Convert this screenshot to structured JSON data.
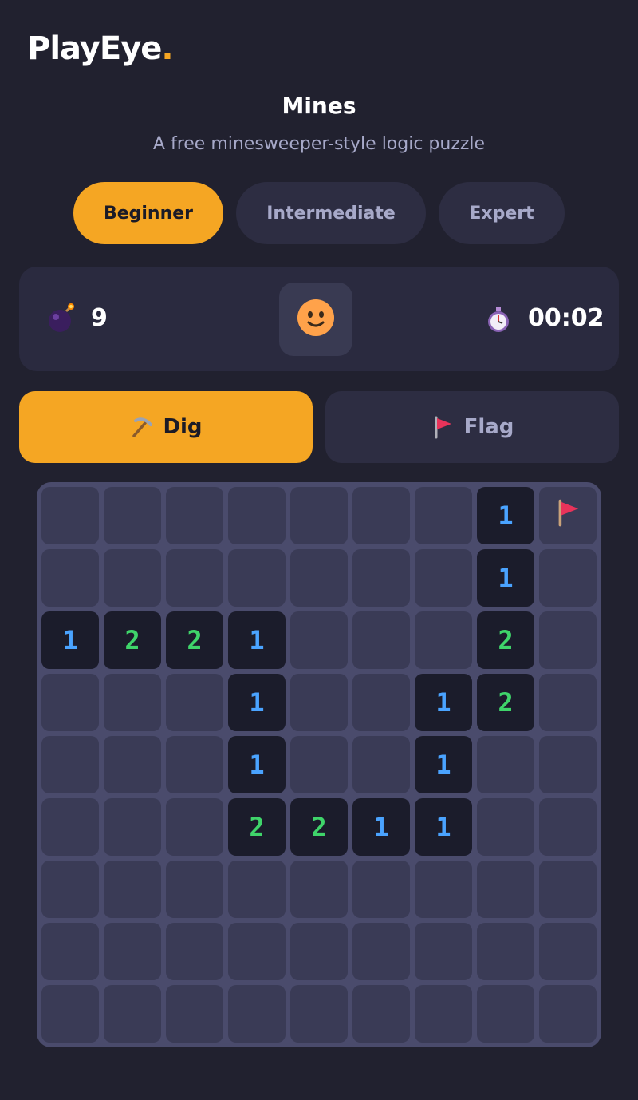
{
  "header": {
    "logo_main": "PlayEye",
    "logo_dot": "."
  },
  "game": {
    "title": "Mines",
    "subtitle": "A free minesweeper-style logic puzzle"
  },
  "difficulty": {
    "options": [
      "Beginner",
      "Intermediate",
      "Expert"
    ],
    "selected": "Beginner"
  },
  "status": {
    "mines_remaining": "9",
    "timer": "00:02",
    "mines_icon": "bomb-icon",
    "face_icon": "smiley-face-icon",
    "timer_icon": "stopwatch-icon"
  },
  "modes": {
    "dig_label": "Dig",
    "flag_label": "Flag",
    "selected": "Dig",
    "dig_icon": "pickaxe-icon",
    "flag_icon": "flag-icon"
  },
  "colors": {
    "accent": "#f5a623",
    "background": "#21212f",
    "number_1": "#4aa3ff",
    "number_2": "#3fd46a"
  },
  "board": {
    "rows": 9,
    "cols": 9,
    "legend": "H = hidden, F = flagged, 0 = revealed empty, digits = adjacent mine count",
    "grid": [
      [
        "H",
        "H",
        "H",
        "H",
        "H",
        "H",
        "H",
        "1",
        "F"
      ],
      [
        "H",
        "H",
        "H",
        "H",
        "H",
        "H",
        "H",
        "1",
        "H"
      ],
      [
        "1",
        "2",
        "2",
        "1",
        "H",
        "H",
        "H",
        "2",
        "H"
      ],
      [
        "H",
        "H",
        "H",
        "1",
        "H",
        "H",
        "1",
        "2",
        "H"
      ],
      [
        "H",
        "H",
        "H",
        "1",
        "H",
        "H",
        "1",
        "H",
        "H"
      ],
      [
        "H",
        "H",
        "H",
        "2",
        "2",
        "1",
        "1",
        "H",
        "H"
      ],
      [
        "H",
        "H",
        "H",
        "H",
        "H",
        "H",
        "H",
        "H",
        "H"
      ],
      [
        "H",
        "H",
        "H",
        "H",
        "H",
        "H",
        "H",
        "H",
        "H"
      ],
      [
        "H",
        "H",
        "H",
        "H",
        "H",
        "H",
        "H",
        "H",
        "H"
      ]
    ]
  }
}
